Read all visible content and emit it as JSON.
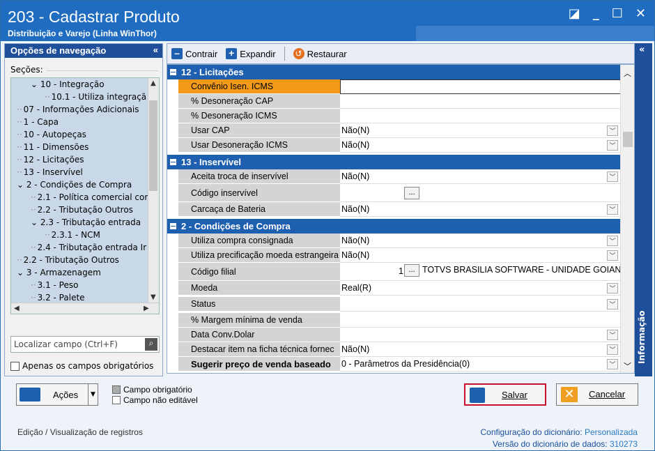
{
  "window": {
    "title": "203 - Cadastrar  Produto",
    "subtitle": "Distribuição e Varejo (Linha WinThor)"
  },
  "nav": {
    "header": "Opções de navegação",
    "sections_label": "Seções:",
    "tree": [
      {
        "label": "10 - Integração",
        "level": 1,
        "expanded": true
      },
      {
        "label": "10.1 - Utiliza integraçã",
        "level": 2
      },
      {
        "label": "07 - Informações Adicionais",
        "level": 0
      },
      {
        "label": "1 - Capa",
        "level": 0
      },
      {
        "label": "10 - Autopeças",
        "level": 0
      },
      {
        "label": "11 - Dimensões",
        "level": 0
      },
      {
        "label": "12 - Licitações",
        "level": 0
      },
      {
        "label": "13 - Inservível",
        "level": 0
      },
      {
        "label": "2 - Condições de Compra",
        "level": 0,
        "expanded": true
      },
      {
        "label": "2.1 - Política comercial com",
        "level": 1
      },
      {
        "label": "2.2 - Tributação Outros",
        "level": 1
      },
      {
        "label": "2.3 - Tributação entrada",
        "level": 1,
        "expanded": true
      },
      {
        "label": "2.3.1 - NCM",
        "level": 2
      },
      {
        "label": "2.4 - Tributação entrada Ir",
        "level": 1
      },
      {
        "label": "2.2 - Tributação Outros",
        "level": 0
      },
      {
        "label": "3 - Armazenagem",
        "level": 0,
        "expanded": true
      },
      {
        "label": "3.1 - Peso",
        "level": 1
      },
      {
        "label": "3.2 - Palete",
        "level": 1
      }
    ],
    "search_placeholder": "Localizar campo (Ctrl+F)",
    "only_required": "Apenas os campos obrigatórios"
  },
  "toolbar": {
    "collapse": "Contrair",
    "expand": "Expandir",
    "restore": "Restaurar"
  },
  "grid": {
    "cat12": "12 - Licitações",
    "cat13": "13 - Inservível",
    "cat2": "2 - Condições de Compra",
    "r1": {
      "label": "Convênio Isen. ICMS",
      "value": ""
    },
    "r2": {
      "label": "% Desoneração CAP",
      "value": ""
    },
    "r3": {
      "label": "% Desoneração ICMS",
      "value": ""
    },
    "r4": {
      "label": "Usar CAP",
      "value": "Não(N)"
    },
    "r5": {
      "label": "Usar Desoneração ICMS",
      "value": "Não(N)"
    },
    "r6": {
      "label": "Aceita troca de inservível",
      "value": "Não(N)"
    },
    "r7": {
      "label": "Código inservível",
      "value": ""
    },
    "r8": {
      "label": "Carcaça de Bateria",
      "value": "Não(N)"
    },
    "r9": {
      "label": "Utiliza compra consignada",
      "value": "Não(N)"
    },
    "r10": {
      "label": "Utiliza precificação moeda estrangeira",
      "value": "Não(N)"
    },
    "r11": {
      "label": "Código filial",
      "code": "1",
      "value": "TOTVS BRASILIA SOFTWARE - UNIDADE GOIANI"
    },
    "r12": {
      "label": "Moeda",
      "value": "Real(R)"
    },
    "r13": {
      "label": "Status",
      "value": ""
    },
    "r14": {
      "label": "% Margem mínima de venda",
      "value": ""
    },
    "r15": {
      "label": "Data Conv.Dolar",
      "value": ""
    },
    "r16": {
      "label": "Destacar item na ficha técnica fornec",
      "value": "Não(N)"
    },
    "r17": {
      "label": "Sugerir preço de venda baseado",
      "value": "0 - Parâmetros da Presidência(0)"
    },
    "ellipsis": "..."
  },
  "info_panel": "Informação",
  "bottom": {
    "actions": "Ações",
    "legend_required": "Campo obrigatório",
    "legend_noedit": "Campo não editável",
    "save": "Salvar",
    "cancel": "Cancelar"
  },
  "status": {
    "left": "Edição / Visualização de registros",
    "config_label": "Configuração do dicionário:",
    "config_value": "Personalizada",
    "version_label": "Versão do dicionário de dados:",
    "version_value": "310273"
  },
  "colors": {
    "title_bar": "#1f6cc1",
    "category": "#1f5fb0",
    "selected_field": "#f39a1b",
    "save_highlight": "#c8102e"
  }
}
